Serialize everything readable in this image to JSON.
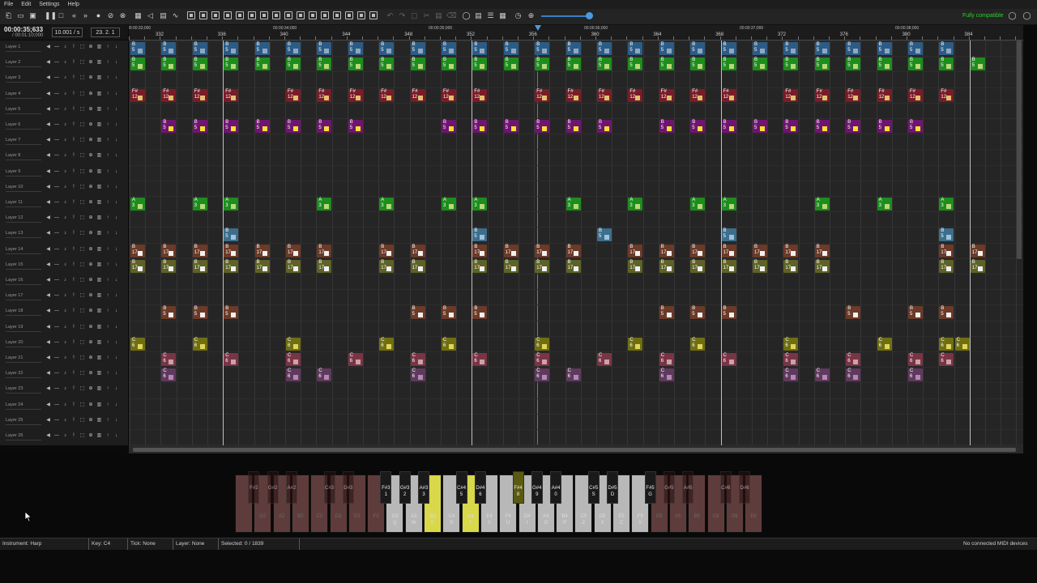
{
  "menu": [
    "File",
    "Edit",
    "Settings",
    "Help"
  ],
  "toolbar": {
    "compat_label": "Fully compatible",
    "icons": [
      "new-song-icon",
      "open-song-icon",
      "save-song-icon",
      "play-pause-icon",
      "stop-icon",
      "rewind-icon",
      "fast-forward-icon",
      "record-icon",
      "mute-tool-icon",
      "loop-icon",
      "keyboard-icon",
      "volume-icon",
      "piano-roll-icon",
      "wave-icon"
    ]
  },
  "header": {
    "time_current": "00:00:35;633",
    "time_total": "/ 00:01:10;000",
    "speed": "10.001 / s",
    "position": "23. 2. 1"
  },
  "ruler": {
    "time_labels": [
      "00:00:33;000",
      "00:00:34;000",
      "00:00:35;000",
      "00:00:36;000",
      "00:00:37;000",
      "00:00:38;000"
    ],
    "bar_labels": [
      "332",
      "336",
      "340",
      "344",
      "348",
      "352",
      "356",
      "360",
      "364",
      "368",
      "372",
      "376",
      "380",
      "384"
    ]
  },
  "layers": [
    "Layer 1",
    "Layer 2",
    "Layer 3",
    "Layer 4",
    "Layer 5",
    "Layer 6",
    "Layer 7",
    "Layer 8",
    "Layer 9",
    "Layer 10",
    "Layer 11",
    "Layer 12",
    "Layer 13",
    "Layer 14",
    "Layer 15",
    "Layer 16",
    "Layer 17",
    "Layer 18",
    "Layer 19",
    "Layer 20",
    "Layer 21",
    "Layer 22",
    "Layer 23",
    "Layer 24",
    "Layer 25",
    "Layer 26"
  ],
  "notes_colors": {
    "blue": "#2c5c86",
    "green": "#1d8d1d",
    "red": "#7a1c26",
    "purple": "#6f1570",
    "olive": "#6f6f12",
    "steel": "#3d6e8c",
    "brown": "#6b3a28",
    "khaki": "#5f6226",
    "pinkred": "#7a3446",
    "mauve": "#5f3a5e"
  },
  "notes": [
    {
      "row": 0,
      "cols": [
        0,
        2,
        4,
        6,
        8,
        10,
        12,
        14,
        16,
        18,
        20,
        22,
        24,
        26,
        28,
        30,
        32,
        34,
        36,
        38,
        40,
        42,
        44,
        46,
        48,
        50,
        52
      ],
      "label": "B",
      "num": "5",
      "color": "blue"
    },
    {
      "row": 1,
      "cols": [
        0,
        2,
        4,
        6,
        8,
        10,
        12,
        14,
        16,
        18,
        20,
        22,
        24,
        26,
        28,
        30,
        32,
        34,
        36,
        38,
        40,
        42,
        44,
        46,
        48,
        50,
        52,
        54
      ],
      "label": "B",
      "num": "5",
      "color": "green"
    },
    {
      "row": 3,
      "cols": [
        0,
        2,
        4,
        6,
        10,
        12,
        14,
        16,
        18,
        20,
        22,
        26,
        28,
        30,
        32,
        34,
        36,
        38,
        42,
        44,
        46,
        48,
        50,
        52
      ],
      "label": "F#",
      "num": "12",
      "color": "red"
    },
    {
      "row": 5,
      "cols": [
        2,
        4,
        6,
        8,
        10,
        12,
        14,
        20,
        22,
        24,
        26,
        28,
        30,
        34,
        36,
        38,
        40,
        42,
        44,
        46,
        48,
        50
      ],
      "label": "B",
      "num": "5",
      "color": "purple"
    },
    {
      "row": 10,
      "cols": [
        0,
        4,
        6,
        12,
        16,
        20,
        22,
        28,
        32,
        36,
        38,
        44,
        48,
        52
      ],
      "label": "A",
      "num": "3",
      "color": "green"
    },
    {
      "row": 12,
      "cols": [
        6,
        22,
        30,
        38,
        52
      ],
      "label": "B",
      "num": "5",
      "color": "steel"
    },
    {
      "row": 13,
      "cols": [
        0,
        2,
        4,
        6,
        8,
        10,
        12,
        16,
        18,
        22,
        24,
        26,
        28,
        32,
        34,
        36,
        38,
        40,
        42,
        44,
        52,
        54
      ],
      "label": "B",
      "num": "17",
      "color": "brown"
    },
    {
      "row": 14,
      "cols": [
        0,
        2,
        4,
        6,
        8,
        10,
        12,
        16,
        18,
        22,
        24,
        26,
        28,
        32,
        34,
        36,
        38,
        40,
        42,
        44,
        52,
        54
      ],
      "label": "B",
      "num": "17",
      "color": "khaki"
    },
    {
      "row": 17,
      "cols": [
        2,
        4,
        6,
        18,
        20,
        22,
        34,
        36,
        38,
        46,
        50,
        52
      ],
      "label": "B",
      "num": "5",
      "color": "brown"
    },
    {
      "row": 19,
      "cols": [
        0,
        4,
        10,
        16,
        20,
        26,
        32,
        36,
        42,
        48,
        52,
        53
      ],
      "label": "C",
      "num": "6",
      "color": "olive"
    },
    {
      "row": 20,
      "cols": [
        2,
        6,
        10,
        14,
        18,
        22,
        26,
        30,
        34,
        38,
        42,
        46,
        50,
        52
      ],
      "label": "C",
      "num": "6",
      "color": "pinkred"
    },
    {
      "row": 21,
      "cols": [
        2,
        10,
        12,
        18,
        26,
        28,
        34,
        42,
        44,
        46,
        50
      ],
      "label": "C",
      "num": "6",
      "color": "mauve"
    }
  ],
  "keyboard": {
    "white": [
      {
        "n": "",
        "c": "",
        "state": "dim"
      },
      {
        "n": "G2",
        "c": "",
        "state": "dim"
      },
      {
        "n": "A2",
        "c": "",
        "state": "dim"
      },
      {
        "n": "B2",
        "c": "",
        "state": "dim"
      },
      {
        "n": "C3",
        "c": "",
        "state": "dim"
      },
      {
        "n": "D3",
        "c": "",
        "state": "dim"
      },
      {
        "n": "E3",
        "c": "",
        "state": "dim"
      },
      {
        "n": "F3",
        "c": "",
        "state": "dim"
      },
      {
        "n": "G3",
        "c": "Q",
        "state": "on"
      },
      {
        "n": "A3",
        "c": "W",
        "state": "on"
      },
      {
        "n": "B3",
        "c": "E",
        "state": "hl"
      },
      {
        "n": "C4",
        "c": "R",
        "state": "on"
      },
      {
        "n": "D4",
        "c": "T",
        "state": "hl"
      },
      {
        "n": "E4",
        "c": "Y",
        "state": "on"
      },
      {
        "n": "F4",
        "c": "U",
        "state": "on"
      },
      {
        "n": "G4",
        "c": "I",
        "state": "on"
      },
      {
        "n": "A4",
        "c": "O",
        "state": "on"
      },
      {
        "n": "B4",
        "c": "P",
        "state": "on"
      },
      {
        "n": "C5",
        "c": "Z",
        "state": "on"
      },
      {
        "n": "D5",
        "c": "X",
        "state": "on"
      },
      {
        "n": "E5",
        "c": "C",
        "state": "on"
      },
      {
        "n": "F5",
        "c": "V",
        "state": "on"
      },
      {
        "n": "G5",
        "c": "",
        "state": "dim"
      },
      {
        "n": "A5",
        "c": "",
        "state": "dim"
      },
      {
        "n": "B5",
        "c": "",
        "state": "dim"
      },
      {
        "n": "C6",
        "c": "",
        "state": "dim"
      },
      {
        "n": "D6",
        "c": "",
        "state": "dim"
      },
      {
        "n": "E6",
        "c": "",
        "state": "dim"
      }
    ],
    "black": [
      {
        "n": "F#2",
        "c": "",
        "state": "dim",
        "after": 1
      },
      {
        "n": "G#2",
        "c": "",
        "state": "dim",
        "after": 2
      },
      {
        "n": "A#2",
        "c": "",
        "state": "dim",
        "after": 3
      },
      {
        "n": "C#3",
        "c": "",
        "state": "dim",
        "after": 5
      },
      {
        "n": "D#3",
        "c": "",
        "state": "dim",
        "after": 6
      },
      {
        "n": "F#3",
        "c": "1",
        "state": "on",
        "after": 8
      },
      {
        "n": "G#3",
        "c": "2",
        "state": "on",
        "after": 9
      },
      {
        "n": "A#3",
        "c": "3",
        "state": "on",
        "after": 10
      },
      {
        "n": "C#4",
        "c": "5",
        "state": "on",
        "after": 12
      },
      {
        "n": "D#4",
        "c": "6",
        "state": "on",
        "after": 13
      },
      {
        "n": "F#4",
        "c": "8",
        "state": "hl",
        "after": 15
      },
      {
        "n": "G#4",
        "c": "9",
        "state": "on",
        "after": 16
      },
      {
        "n": "A#4",
        "c": "0",
        "state": "on",
        "after": 17
      },
      {
        "n": "C#5",
        "c": "S",
        "state": "on",
        "after": 19
      },
      {
        "n": "D#5",
        "c": "D",
        "state": "on",
        "after": 20
      },
      {
        "n": "F#5",
        "c": "G",
        "state": "on",
        "after": 22
      },
      {
        "n": "G#5",
        "c": "",
        "state": "dim",
        "after": 23
      },
      {
        "n": "A#5",
        "c": "",
        "state": "dim",
        "after": 24
      },
      {
        "n": "C#6",
        "c": "",
        "state": "dim",
        "after": 26
      },
      {
        "n": "D#6",
        "c": "",
        "state": "dim",
        "after": 27
      }
    ]
  },
  "status": {
    "instrument": "Instrument: Harp",
    "key": "Key: C4",
    "tick": "Tick: None",
    "layer": "Layer: None",
    "selected": "Selected: 0 / 1839",
    "midi": "No connected MIDI devices"
  }
}
